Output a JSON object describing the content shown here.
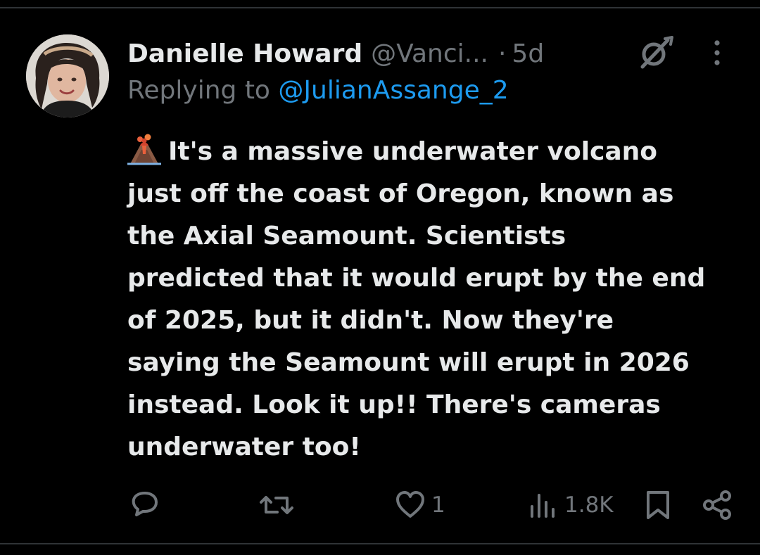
{
  "post": {
    "author": {
      "display_name": "Danielle Howard",
      "handle": "@Vanci...",
      "avatar": "profile-photo"
    },
    "separator": "·",
    "time": "5d",
    "reply_prefix": "Replying to",
    "reply_to": "@JulianAssange_2",
    "emoji": "volcano",
    "text_lines": [
      "It's a massive underwater volcano",
      "just off the coast of Oregon, known as",
      "the Axial Seamount. Scientists",
      "predicted that it would erupt by the end",
      "of 2025, but it didn't. Now they're",
      "saying the Seamount will erupt in 2026",
      "instead. Look it up!! There's cameras",
      "underwater too!"
    ],
    "actions": {
      "reply": {
        "icon": "reply-icon"
      },
      "repost": {
        "icon": "repost-icon"
      },
      "like": {
        "icon": "heart-icon",
        "count": "1"
      },
      "views": {
        "icon": "views-icon",
        "count": "1.8K"
      },
      "bookmark": {
        "icon": "bookmark-icon"
      },
      "share": {
        "icon": "share-icon"
      }
    },
    "header_icons": [
      "grok-icon",
      "more-icon"
    ]
  },
  "colors": {
    "background": "#000000",
    "primary_text": "#e7e9ea",
    "secondary_text": "#71767b",
    "link": "#1d9bf0",
    "divider": "#2f3336"
  }
}
